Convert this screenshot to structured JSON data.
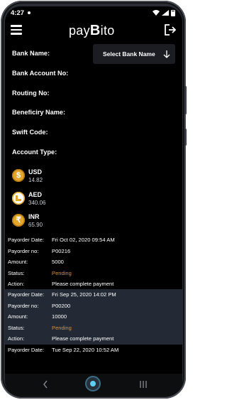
{
  "status_bar": {
    "time": "4:27"
  },
  "header": {
    "logo_prefix": "pay",
    "logo_b": "B",
    "logo_suffix": "ito"
  },
  "form": {
    "bank_name_label": "Bank Name:",
    "select_bank_label": "Select Bank Name",
    "account_no_label": "Bank Account No:",
    "routing_label": "Routing No:",
    "beneficiary_label": "Beneficiry Name:",
    "swift_label": "Swift Code:",
    "account_type_label": "Account Type:"
  },
  "wallets": [
    {
      "currency": "USD",
      "amount": "14.82",
      "icon": "dollar-coin-icon"
    },
    {
      "currency": "AED",
      "amount": "340.06",
      "icon": "dirham-coin-icon"
    },
    {
      "currency": "INR",
      "amount": "65.90",
      "icon": "rupee-coin-icon"
    }
  ],
  "orders": [
    {
      "date_label": "Payorder Date:",
      "date": "Fri Oct 02, 2020 09:54 AM",
      "no_label": "Payorder no:",
      "no": "P00216",
      "amount_label": "Amount:",
      "amount": "5000",
      "status_label": "Status:",
      "status": "Pending",
      "action_label": "Action:",
      "action": "Please complete payment"
    },
    {
      "date_label": "Payorder Date:",
      "date": "Fri Sep 25, 2020 14:02 PM",
      "no_label": "Payorder no:",
      "no": "P00200",
      "amount_label": "Amount:",
      "amount": "10000",
      "status_label": "Status:",
      "status": "Pending",
      "action_label": "Action:",
      "action": "Please complete payment"
    },
    {
      "date_label": "Payorder Date:",
      "date": "Tue Sep 22, 2020 10:52 AM"
    }
  ],
  "colors": {
    "background": "#000000",
    "pending": "#e48a2c",
    "alt_row": "#232a35",
    "coin_gold": "#e3a72d"
  }
}
